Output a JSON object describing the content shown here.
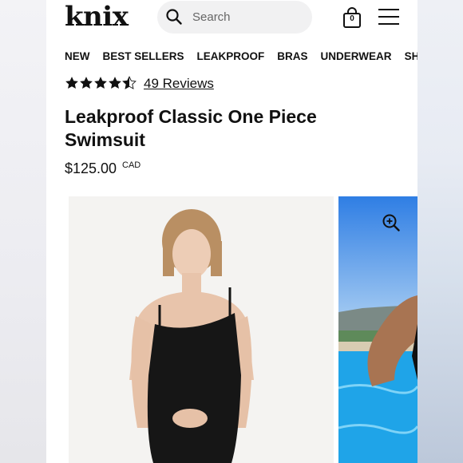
{
  "header": {
    "logo": "knix",
    "search": {
      "placeholder": "Search"
    },
    "cart": {
      "count": "0"
    }
  },
  "nav": {
    "items": [
      "NEW",
      "BEST SELLERS",
      "LEAKPROOF",
      "BRAS",
      "UNDERWEAR",
      "SHA"
    ]
  },
  "product": {
    "rating": 4.5,
    "reviews_label": "49 Reviews",
    "title": "Leakproof Classic One Piece Swimsuit",
    "price": "$125.00",
    "currency": "CAD"
  },
  "colors": {
    "text": "#111111",
    "search_bg": "#f1f1f2"
  },
  "icons": [
    "search-icon",
    "cart-icon",
    "menu-icon",
    "star-icon",
    "zoom-in-icon"
  ]
}
